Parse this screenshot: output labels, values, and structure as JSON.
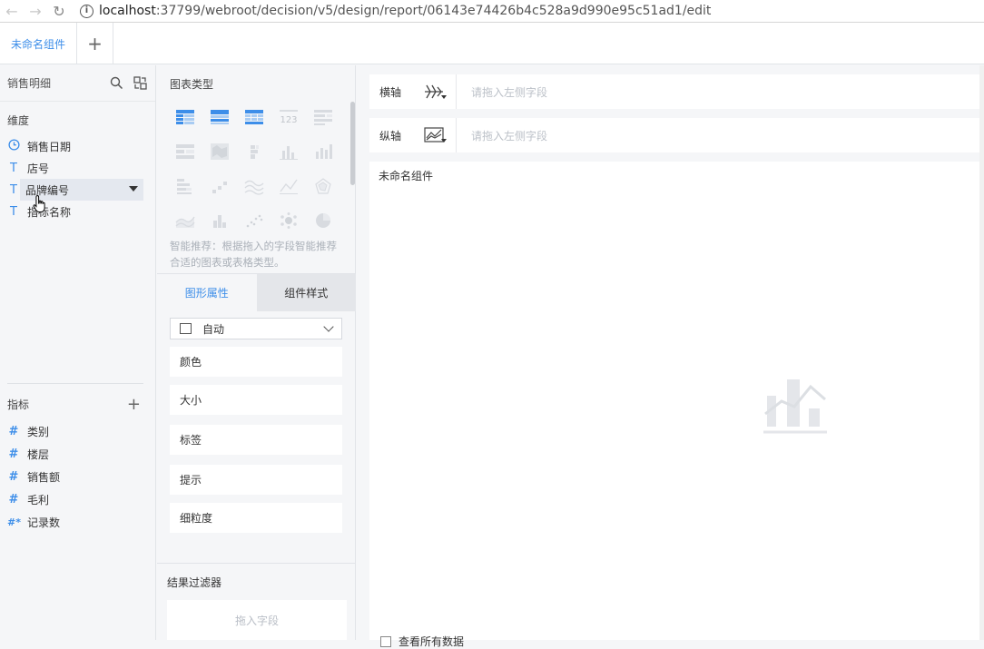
{
  "browser": {
    "url_host": "localhost",
    "url_rest": ":37799/webroot/decision/v5/design/report/06143e74426b4c528a9d990e95c51ad1/edit"
  },
  "tabs": [
    {
      "label": "未命名组件"
    }
  ],
  "data_panel": {
    "title": "销售明细",
    "dimension_label": "维度",
    "dimensions": [
      {
        "type_glyph": "clock",
        "label": "销售日期"
      },
      {
        "type_glyph": "T",
        "label": "店号"
      },
      {
        "type_glyph": "T",
        "label": "品牌编号"
      },
      {
        "type_glyph": "T",
        "label": "指标名称"
      }
    ],
    "metric_label": "指标",
    "metrics": [
      {
        "type_glyph": "#",
        "label": "类别"
      },
      {
        "type_glyph": "#",
        "label": "楼层"
      },
      {
        "type_glyph": "#",
        "label": "销售额"
      },
      {
        "type_glyph": "#",
        "label": "毛利"
      },
      {
        "type_glyph": "#*",
        "label": "记录数"
      }
    ]
  },
  "config_panel": {
    "chart_type_title": "图表类型",
    "hint": "智能推荐：根据拖入的字段智能推荐合适的图表或表格类型。",
    "tab_graphic": "图形属性",
    "tab_style": "组件样式",
    "select_value": "自动",
    "props": {
      "color": "颜色",
      "size": "大小",
      "label": "标签",
      "tooltip": "提示",
      "granularity": "细粒度"
    },
    "filter_title": "结果过滤器",
    "filter_placeholder": "拖入字段"
  },
  "canvas": {
    "x_axis_label": "横轴",
    "y_axis_label": "纵轴",
    "axis_placeholder": "请拖入左侧字段",
    "component_title": "未命名组件",
    "show_all": "查看所有数据"
  },
  "colors": {
    "accent": "#3d8ee9",
    "chart_icon_disabled": "#d8dbe0"
  }
}
